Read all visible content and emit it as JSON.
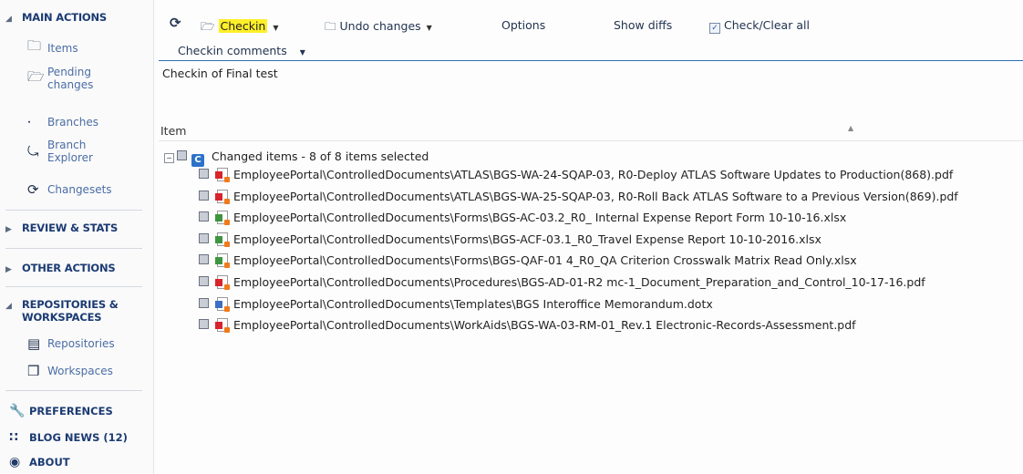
{
  "sidebar": {
    "main_actions": {
      "label": "MAIN ACTIONS",
      "items": [
        {
          "label": "Items",
          "icon": "folder-icon"
        },
        {
          "label": "Pending changes",
          "line1": "Pending",
          "line2": "changes",
          "icon": "pending-changes-icon"
        },
        {
          "label": "Branches",
          "icon": "branches-icon"
        },
        {
          "label": "Branch Explorer",
          "line1": "Branch",
          "line2": "Explorer",
          "icon": "branch-explorer-icon"
        },
        {
          "label": "Changesets",
          "icon": "changesets-icon"
        }
      ]
    },
    "review_stats": {
      "label": "REVIEW & STATS"
    },
    "other_actions": {
      "label": "OTHER ACTIONS"
    },
    "repositories": {
      "label_line1": "REPOSITORIES &",
      "label_line2": "WORKSPACES",
      "items": [
        {
          "label": "Repositories",
          "icon": "repositories-icon"
        },
        {
          "label": "Workspaces",
          "icon": "workspaces-icon"
        }
      ]
    },
    "preferences": {
      "label": "PREFERENCES",
      "icon": "wrench-icon"
    },
    "blog_news": {
      "label": "BLOG NEWS (12)",
      "icon": "rss-icon"
    },
    "about": {
      "label": "ABOUT",
      "icon": "info-icon"
    }
  },
  "toolbar": {
    "refresh_icon": "refresh-icon",
    "checkin_label": "Checkin",
    "undo_label": "Undo changes",
    "options_label": "Options",
    "show_diffs_label": "Show diffs",
    "check_clear_label": "Check/Clear all",
    "check_clear_checked": true
  },
  "comments": {
    "header": "Checkin comments",
    "text": "Checkin of Final test"
  },
  "grid": {
    "column_header": "Item",
    "group_label": "Changed items - 8 of 8 items selected",
    "rows": [
      {
        "type": "pdf",
        "path": "EmployeePortal\\ControlledDocuments\\ATLAS\\BGS-WA-24-SQAP-03, R0-Deploy ATLAS Software Updates to Production(868).pdf"
      },
      {
        "type": "pdf",
        "path": "EmployeePortal\\ControlledDocuments\\ATLAS\\BGS-WA-25-SQAP-03, R0-Roll Back ATLAS Software to a Previous Version(869).pdf"
      },
      {
        "type": "xlsx",
        "path": "EmployeePortal\\ControlledDocuments\\Forms\\BGS-AC-03.2_R0_ Internal Expense Report Form 10-10-16.xlsx"
      },
      {
        "type": "xlsx",
        "path": "EmployeePortal\\ControlledDocuments\\Forms\\BGS-ACF-03.1_R0_Travel Expense Report 10-10-2016.xlsx"
      },
      {
        "type": "xlsx",
        "path": "EmployeePortal\\ControlledDocuments\\Forms\\BGS-QAF-01 4_R0_QA Criterion Crosswalk Matrix Read Only.xlsx"
      },
      {
        "type": "pdf",
        "path": "EmployeePortal\\ControlledDocuments\\Procedures\\BGS-AD-01-R2 mc-1_Document_Preparation_and_Control_10-17-16.pdf"
      },
      {
        "type": "dotx",
        "path": "EmployeePortal\\ControlledDocuments\\Templates\\BGS Interoffice Memorandum.dotx"
      },
      {
        "type": "pdf",
        "path": "EmployeePortal\\ControlledDocuments\\WorkAids\\BGS-WA-03-RM-01_Rev.1 Electronic-Records-Assessment.pdf"
      }
    ]
  }
}
